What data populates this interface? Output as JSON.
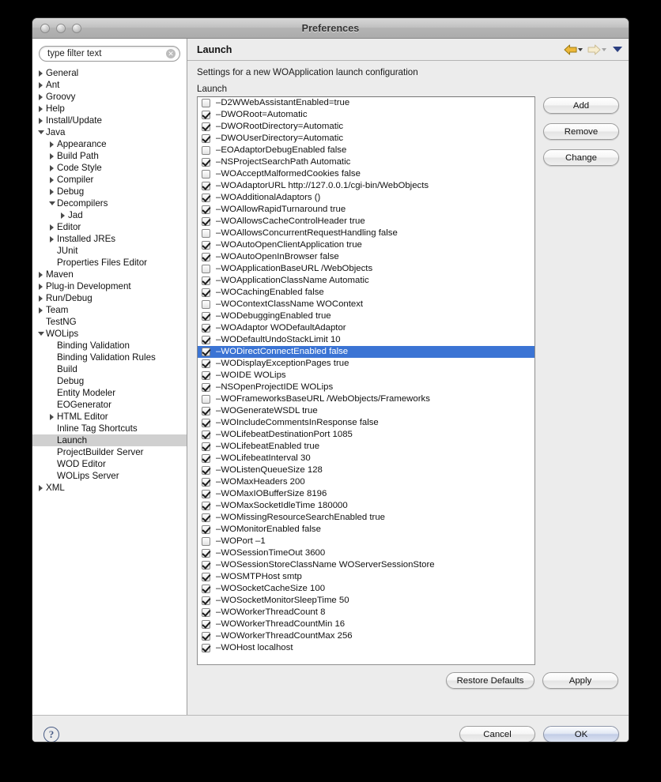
{
  "window": {
    "title": "Preferences"
  },
  "sidebar": {
    "filter": {
      "value": "type filter text",
      "placeholder": "type filter text",
      "clear_icon": "clear-circle-icon"
    },
    "tree": [
      {
        "label": "General",
        "depth": 0,
        "twisty": "right"
      },
      {
        "label": "Ant",
        "depth": 0,
        "twisty": "right"
      },
      {
        "label": "Groovy",
        "depth": 0,
        "twisty": "right"
      },
      {
        "label": "Help",
        "depth": 0,
        "twisty": "right"
      },
      {
        "label": "Install/Update",
        "depth": 0,
        "twisty": "right"
      },
      {
        "label": "Java",
        "depth": 0,
        "twisty": "down"
      },
      {
        "label": "Appearance",
        "depth": 1,
        "twisty": "right"
      },
      {
        "label": "Build Path",
        "depth": 1,
        "twisty": "right"
      },
      {
        "label": "Code Style",
        "depth": 1,
        "twisty": "right"
      },
      {
        "label": "Compiler",
        "depth": 1,
        "twisty": "right"
      },
      {
        "label": "Debug",
        "depth": 1,
        "twisty": "right"
      },
      {
        "label": "Decompilers",
        "depth": 1,
        "twisty": "down"
      },
      {
        "label": "Jad",
        "depth": 2,
        "twisty": "right"
      },
      {
        "label": "Editor",
        "depth": 1,
        "twisty": "right"
      },
      {
        "label": "Installed JREs",
        "depth": 1,
        "twisty": "right"
      },
      {
        "label": "JUnit",
        "depth": 1,
        "twisty": "none"
      },
      {
        "label": "Properties Files Editor",
        "depth": 1,
        "twisty": "none"
      },
      {
        "label": "Maven",
        "depth": 0,
        "twisty": "right"
      },
      {
        "label": "Plug-in Development",
        "depth": 0,
        "twisty": "right"
      },
      {
        "label": "Run/Debug",
        "depth": 0,
        "twisty": "right"
      },
      {
        "label": "Team",
        "depth": 0,
        "twisty": "right"
      },
      {
        "label": "TestNG",
        "depth": 0,
        "twisty": "none"
      },
      {
        "label": "WOLips",
        "depth": 0,
        "twisty": "down"
      },
      {
        "label": "Binding Validation",
        "depth": 1,
        "twisty": "none"
      },
      {
        "label": "Binding Validation Rules",
        "depth": 1,
        "twisty": "none"
      },
      {
        "label": "Build",
        "depth": 1,
        "twisty": "none"
      },
      {
        "label": "Debug",
        "depth": 1,
        "twisty": "none"
      },
      {
        "label": "Entity Modeler",
        "depth": 1,
        "twisty": "none"
      },
      {
        "label": "EOGenerator",
        "depth": 1,
        "twisty": "none"
      },
      {
        "label": "HTML Editor",
        "depth": 1,
        "twisty": "right"
      },
      {
        "label": "Inline Tag Shortcuts",
        "depth": 1,
        "twisty": "none"
      },
      {
        "label": "Launch",
        "depth": 1,
        "twisty": "none",
        "selected": true
      },
      {
        "label": "ProjectBuilder Server",
        "depth": 1,
        "twisty": "none"
      },
      {
        "label": "WOD Editor",
        "depth": 1,
        "twisty": "none"
      },
      {
        "label": "WOLips Server",
        "depth": 1,
        "twisty": "none"
      },
      {
        "label": "XML",
        "depth": 0,
        "twisty": "right"
      }
    ]
  },
  "content": {
    "page_title": "Launch",
    "description": "Settings for a new WOApplication launch configuration",
    "group_label": "Launch",
    "nav": {
      "back_icon": "back-arrow-icon",
      "back_menu_icon": "chevron-down-icon",
      "forward_icon": "forward-arrow-icon",
      "forward_menu_icon": "chevron-down-icon",
      "history_icon": "chevron-down-icon"
    },
    "side_buttons": [
      {
        "label": "Add",
        "name": "add-button"
      },
      {
        "label": "Remove",
        "name": "remove-button"
      },
      {
        "label": "Change",
        "name": "change-button"
      }
    ],
    "bottom_buttons": [
      {
        "label": "Restore Defaults",
        "name": "restore-defaults-button"
      },
      {
        "label": "Apply",
        "name": "apply-button"
      }
    ],
    "arguments": [
      {
        "checked": false,
        "text": "–D2WWebAssistantEnabled=true"
      },
      {
        "checked": true,
        "text": "–DWORoot=Automatic"
      },
      {
        "checked": true,
        "text": "–DWORootDirectory=Automatic"
      },
      {
        "checked": true,
        "text": "–DWOUserDirectory=Automatic"
      },
      {
        "checked": false,
        "text": "–EOAdaptorDebugEnabled false"
      },
      {
        "checked": true,
        "text": "–NSProjectSearchPath Automatic"
      },
      {
        "checked": false,
        "text": "–WOAcceptMalformedCookies false"
      },
      {
        "checked": true,
        "text": "–WOAdaptorURL http://127.0.0.1/cgi-bin/WebObjects"
      },
      {
        "checked": true,
        "text": "–WOAdditionalAdaptors ()"
      },
      {
        "checked": true,
        "text": "–WOAllowRapidTurnaround true"
      },
      {
        "checked": true,
        "text": "–WOAllowsCacheControlHeader true"
      },
      {
        "checked": false,
        "text": "–WOAllowsConcurrentRequestHandling false"
      },
      {
        "checked": true,
        "text": "–WOAutoOpenClientApplication true"
      },
      {
        "checked": true,
        "text": "–WOAutoOpenInBrowser false"
      },
      {
        "checked": false,
        "text": "–WOApplicationBaseURL /WebObjects"
      },
      {
        "checked": true,
        "text": "–WOApplicationClassName Automatic"
      },
      {
        "checked": true,
        "text": "–WOCachingEnabled false"
      },
      {
        "checked": false,
        "text": "–WOContextClassName WOContext"
      },
      {
        "checked": true,
        "text": "–WODebuggingEnabled true"
      },
      {
        "checked": true,
        "text": "–WOAdaptor WODefaultAdaptor"
      },
      {
        "checked": true,
        "text": "–WODefaultUndoStackLimit 10"
      },
      {
        "checked": true,
        "text": "–WODirectConnectEnabled false",
        "selected": true
      },
      {
        "checked": true,
        "text": "–WODisplayExceptionPages true"
      },
      {
        "checked": true,
        "text": "–WOIDE WOLips"
      },
      {
        "checked": true,
        "text": "–NSOpenProjectIDE WOLips"
      },
      {
        "checked": false,
        "text": "–WOFrameworksBaseURL /WebObjects/Frameworks"
      },
      {
        "checked": true,
        "text": "–WOGenerateWSDL true"
      },
      {
        "checked": true,
        "text": "–WOIncludeCommentsInResponse false"
      },
      {
        "checked": true,
        "text": "–WOLifebeatDestinationPort 1085"
      },
      {
        "checked": true,
        "text": "–WOLifebeatEnabled true"
      },
      {
        "checked": true,
        "text": "–WOLifebeatInterval 30"
      },
      {
        "checked": true,
        "text": "–WOListenQueueSize 128"
      },
      {
        "checked": true,
        "text": "–WOMaxHeaders 200"
      },
      {
        "checked": true,
        "text": "–WOMaxIOBufferSize 8196"
      },
      {
        "checked": true,
        "text": "–WOMaxSocketIdleTime 180000"
      },
      {
        "checked": true,
        "text": "–WOMissingResourceSearchEnabled true"
      },
      {
        "checked": true,
        "text": "–WOMonitorEnabled false"
      },
      {
        "checked": false,
        "text": "–WOPort –1"
      },
      {
        "checked": true,
        "text": "–WOSessionTimeOut 3600"
      },
      {
        "checked": true,
        "text": "–WOSessionStoreClassName WOServerSessionStore"
      },
      {
        "checked": true,
        "text": "–WOSMTPHost smtp"
      },
      {
        "checked": true,
        "text": "–WOSocketCacheSize 100"
      },
      {
        "checked": true,
        "text": "–WOSocketMonitorSleepTime 50"
      },
      {
        "checked": true,
        "text": "–WOWorkerThreadCount 8"
      },
      {
        "checked": true,
        "text": "–WOWorkerThreadCountMin 16"
      },
      {
        "checked": true,
        "text": "–WOWorkerThreadCountMax 256"
      },
      {
        "checked": true,
        "text": "–WOHost localhost"
      }
    ]
  },
  "footer": {
    "help_label": "?",
    "help_icon": "help-question-icon",
    "buttons": [
      {
        "label": "Cancel",
        "name": "cancel-button",
        "default": false
      },
      {
        "label": "OK",
        "name": "ok-button",
        "default": true
      }
    ]
  },
  "colors": {
    "selection_blue": "#3b74d4",
    "inactive_selection": "#d0d0d0",
    "window_bg": "#ececec",
    "back_arrow": "#e0a72c",
    "forward_arrow": "#e8d9a8",
    "history_chevron": "#2b3f80"
  }
}
